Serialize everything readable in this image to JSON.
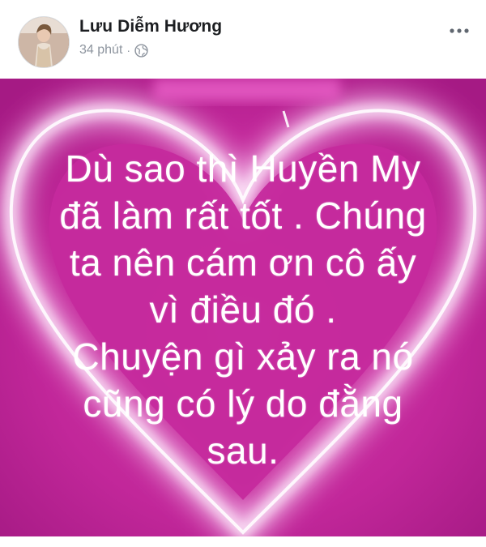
{
  "post": {
    "author": "Lưu Diễm Hương",
    "time": "34 phút",
    "separator": "·",
    "audience_icon": "globe-icon",
    "more_icon": "more-horizontal-icon",
    "text_lines": [
      "Dù sao thì Huyền My",
      "đã làm rất tốt . Chúng",
      "ta nên cám ơn cô ấy",
      "vì điều đó .",
      "Chuyện gì xảy ra nó",
      "cũng có lý do đằng",
      "sau."
    ]
  },
  "colors": {
    "card_background": "#c8239a",
    "heart_glow": "#f6c8ee",
    "text": "#ffffff"
  }
}
